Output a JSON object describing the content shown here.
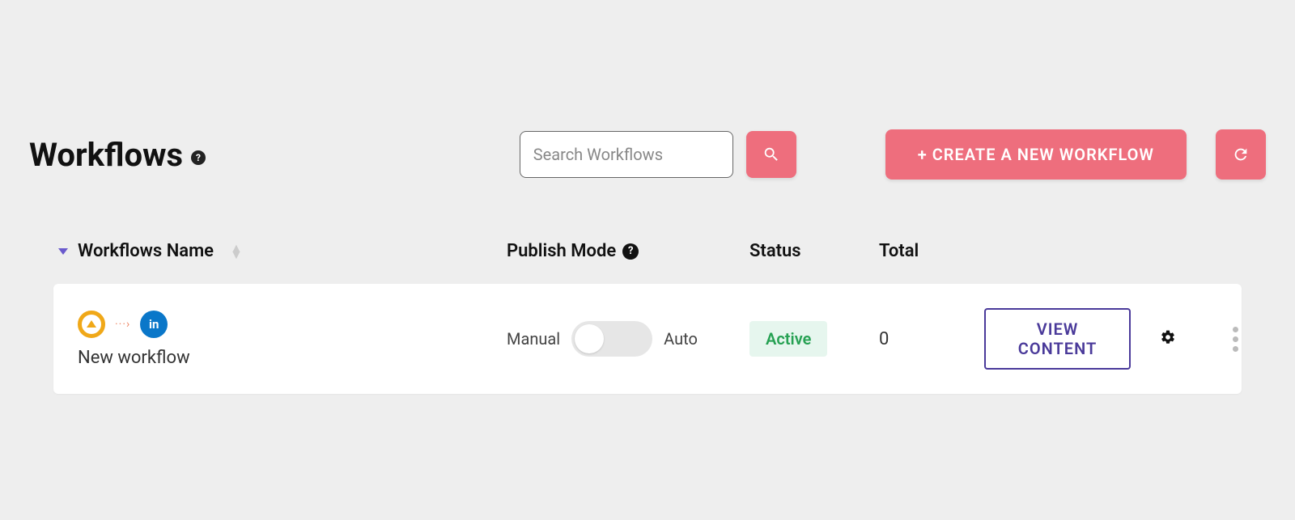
{
  "header": {
    "title": "Workflows",
    "search_placeholder": "Search Workflows",
    "create_button": "+ CREATE A NEW WORKFLOW"
  },
  "columns": {
    "name": "Workflows Name",
    "publish_mode": "Publish Mode",
    "status": "Status",
    "total": "Total"
  },
  "row": {
    "name": "New workflow",
    "mode_left": "Manual",
    "mode_right": "Auto",
    "publish_mode_value": "Manual",
    "status": "Active",
    "total": "0",
    "view_button": "VIEW CONTENT",
    "dest_icon_text": "in"
  }
}
